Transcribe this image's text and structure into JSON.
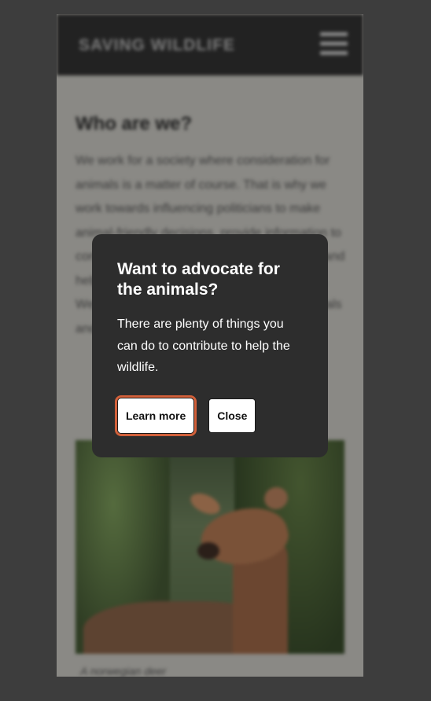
{
  "site": {
    "brand": "SAVING WILDLIFE",
    "menu_icon": "hamburger-menu-icon"
  },
  "article": {
    "heading": "Who are we?",
    "body": "We work for a society where consideration for animals is a matter of course. That is why we work towards influencing politicians to make animal-friendly decisions, provide information to consumers to make animal-friendly choices, and help people who want to live closer to nature. We also work to raise awareness about animals and their welfare.",
    "image_caption": "A norwegian deer"
  },
  "dialog": {
    "title": "Want to advocate for the animals?",
    "message": "There are plenty of things you can do to contribute to help the wildlife.",
    "learn_more_label": "Learn more",
    "close_label": "Close"
  },
  "colors": {
    "backdrop": "#3d3d3d",
    "dialog_bg": "#2d2d2d",
    "focus_ring": "#d2603a",
    "header_bg": "#222222"
  }
}
